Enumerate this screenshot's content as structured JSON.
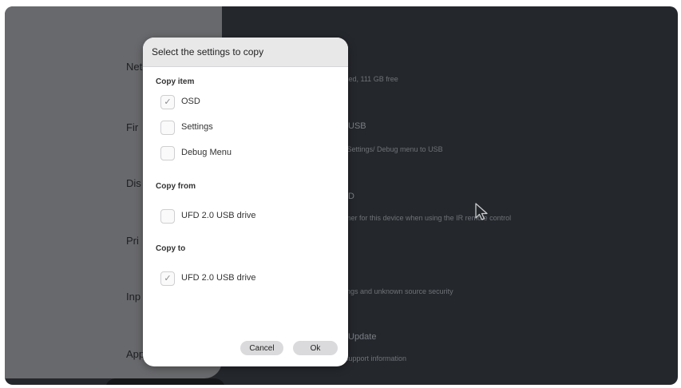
{
  "left_nav": {
    "items": [
      {
        "label": "Net"
      },
      {
        "label": "Fir"
      },
      {
        "label": "Dis"
      },
      {
        "label": "Pri"
      },
      {
        "label": "Inp"
      },
      {
        "label": "App"
      }
    ]
  },
  "right_panel": {
    "lines": [
      {
        "text": "sed, 111 GB free"
      },
      {
        "text": "USB"
      },
      {
        "text": "/Settings/ Debug menu to USB"
      },
      {
        "text": "D"
      },
      {
        "text": "mer for this device when using the IR remote control"
      },
      {
        "text": "ings and unknown source security"
      },
      {
        "text": "Update"
      },
      {
        "text": "support information"
      }
    ]
  },
  "dialog": {
    "title": "Select the settings to copy",
    "copy_item": {
      "label": "Copy item",
      "options": [
        {
          "label": "OSD",
          "checked": true
        },
        {
          "label": "Settings",
          "checked": false
        },
        {
          "label": "Debug Menu",
          "checked": false
        }
      ]
    },
    "copy_from": {
      "label": "Copy from",
      "options": [
        {
          "label": "UFD 2.0 USB drive",
          "checked": false
        }
      ]
    },
    "copy_to": {
      "label": "Copy to",
      "options": [
        {
          "label": "UFD 2.0 USB drive",
          "checked": true
        }
      ]
    },
    "check_glyph": "✓",
    "cancel_label": "Cancel",
    "ok_label": "Ok"
  },
  "colors": {
    "background": "#24272c",
    "left_panel": "#68696c",
    "dialog": "#ffffff",
    "button": "#dadadc"
  }
}
